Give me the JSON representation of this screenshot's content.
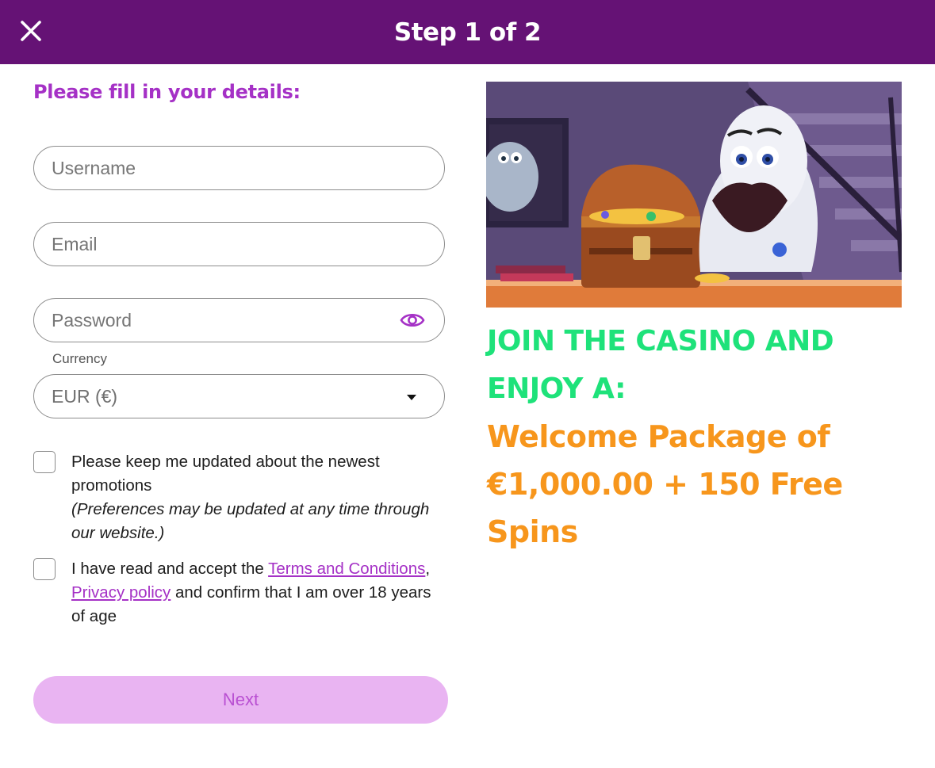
{
  "header": {
    "title": "Step 1 of 2",
    "close_icon": "close-icon"
  },
  "form": {
    "heading": "Please fill in your details:",
    "username_placeholder": "Username",
    "email_placeholder": "Email",
    "password_placeholder": "Password",
    "password_icon": "eye-icon",
    "currency_label": "Currency",
    "currency_value": "EUR (€)",
    "currency_icon": "caret-down-icon",
    "promo_checkbox": {
      "checked": false,
      "text": "Please keep me updated about the newest promotions",
      "note": "(Preferences may be updated at any time through our website.)"
    },
    "terms_checkbox": {
      "checked": false,
      "prefix": "I have read and accept the ",
      "terms_link": "Terms and Conditions",
      "comma": ",",
      "privacy_link": "Privacy policy",
      "suffix": " and confirm that I am over 18 years of age"
    },
    "next_label": "Next"
  },
  "promo": {
    "image": "casino-ghost-treasure-illustration",
    "title": "JOIN THE CASINO AND ENJOY A:",
    "offer": "Welcome Package of €1,000.00 + 150 Free Spins"
  },
  "colors": {
    "header_bg": "#651275",
    "accent_purple": "#a531c6",
    "promo_green": "#1ee27a",
    "promo_orange": "#f7961c",
    "button_disabled_bg": "#e9b4f2"
  }
}
